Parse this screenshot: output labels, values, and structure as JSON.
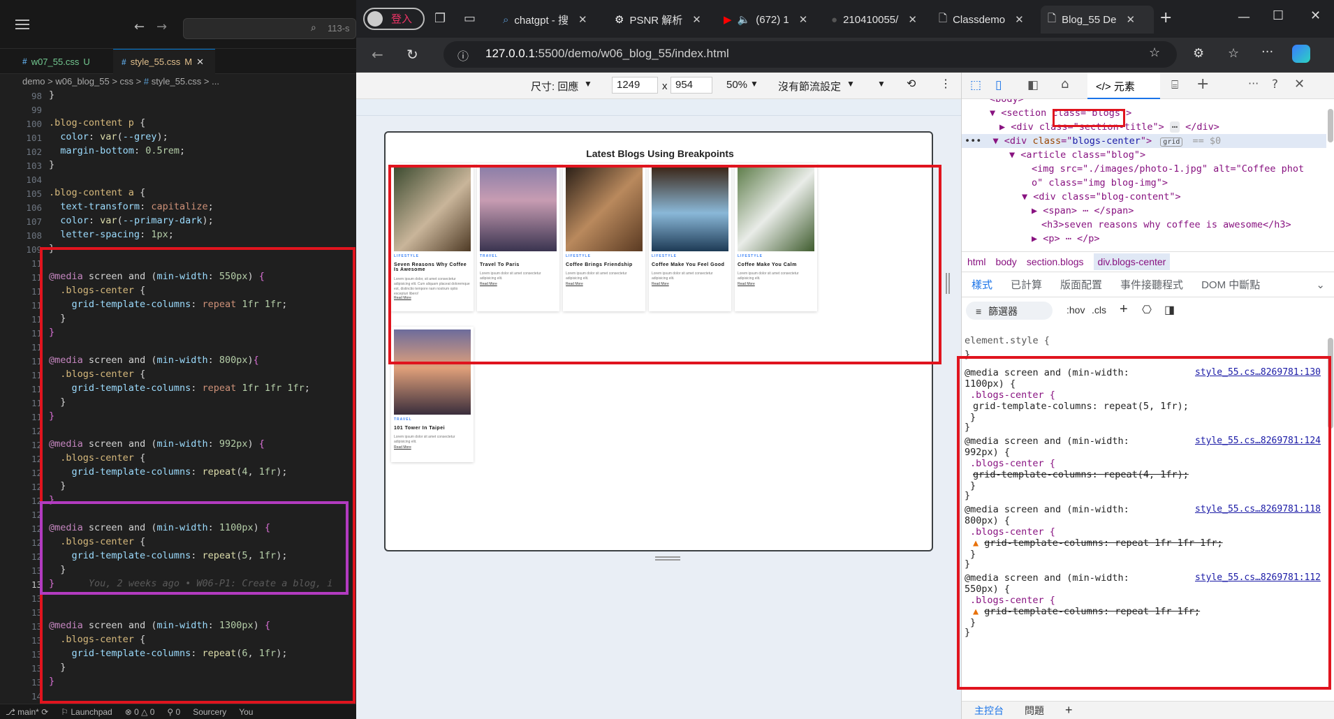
{
  "vscode": {
    "tabs": [
      {
        "label": "w07_55.css",
        "status": "U"
      },
      {
        "label": "style_55.css",
        "status": "M"
      }
    ],
    "breadcrumb": [
      "demo",
      "w06_blog_55",
      "css",
      "#",
      "style_55.css",
      "..."
    ],
    "search_text": "113-s",
    "line_numbers": [
      "98",
      "99",
      "100",
      "101",
      "102",
      "103",
      "104",
      "105",
      "106",
      "107",
      "108",
      "109",
      "11",
      "11",
      "11",
      "11",
      "11",
      "11",
      "11",
      "11",
      "11",
      "11",
      "11",
      "11",
      "12",
      "12",
      "12",
      "12",
      "12",
      "12",
      "12",
      "12",
      "12",
      "12",
      "13",
      "13",
      "13",
      "13",
      "13",
      "13",
      "13",
      "13",
      "13",
      "14"
    ],
    "status": {
      "branch": "main*",
      "launchpad": "Launchpad",
      "problems": "0 △ 0",
      "ports": "0",
      "sourcery": "Sourcery",
      "you": "You"
    },
    "blame": "You, 2 weeks ago • W06-P1: Create a blog, i"
  },
  "browser": {
    "profile_label": "登入",
    "tabs": [
      {
        "label": "chatgpt - 搜"
      },
      {
        "label": "PSNR 解析"
      },
      {
        "label": "(672) 1"
      },
      {
        "label": "210410055/"
      },
      {
        "label": "Classdemo"
      },
      {
        "label": "Blog_55 De"
      }
    ],
    "url_host": "127.0.0.1",
    "url_path": ":5500/demo/w06_blog_55/index.html",
    "device_toolbar": {
      "size_label": "尺寸: 回應",
      "width": "1249",
      "times": "x",
      "height": "954",
      "zoom": "50%",
      "throttle": "沒有節流設定"
    }
  },
  "page": {
    "title": "Latest Blogs Using Breakpoints",
    "cards": [
      {
        "category": "LIFESTYLE",
        "title": "Seven Reasons Why Coffee Is Awesome",
        "text": "Lorem ipsum dolor, sit amet consectetur adipisicing elit. Cum aliquam placeat doloremque est, distinctio tempore nam nostrum optio excepturi libero!",
        "link": "Read More"
      },
      {
        "category": "TRAVEL",
        "title": "Travel To Paris",
        "text": "Lorem ipsum dolor sit amet consectetur adipisicing elit.",
        "link": "Read More"
      },
      {
        "category": "LIFESTYLE",
        "title": "Coffee Brings Friendship",
        "text": "Lorem ipsum dolor sit amet consectetur adipisicing elit.",
        "link": "Read More"
      },
      {
        "category": "LIFESTYLE",
        "title": "Coffee Make You Feel Good",
        "text": "Lorem ipsum dolor sit amet consectetur adipisicing elit.",
        "link": "Read More"
      },
      {
        "category": "LIFESTYLE",
        "title": "Coffee Make You Calm",
        "text": "Lorem ipsum dolor sit amet consectetur adipisicing elit.",
        "link": "Read More"
      },
      {
        "category": "TRAVEL",
        "title": "101 Tower In Taipei",
        "text": "Lorem ipsum dolor sit amet consectetur adipisicing elit.",
        "link": "Read More"
      }
    ]
  },
  "devtools": {
    "tabs": [
      "元素"
    ],
    "dom": {
      "body": "<body>",
      "section_open": "<section class=\"blogs\">",
      "section_title": "<div class=\"section-title\">",
      "blogs_center_class": "blogs-center",
      "grid_badge": "grid",
      "eq": "== $0",
      "article": "<article class=\"blog\">",
      "img_line1": "<img src=\"./images/photo-1.jpg\" alt=\"Coffee phot",
      "img_line2": "o\" class=\"img blog-img\">",
      "blog_content": "<div class=\"blog-content\">",
      "span": "<span>",
      "h3": "<h3>seven reasons why coffee is awesome</h3>",
      "p": "<p>"
    },
    "crumbs": [
      "html",
      "body",
      "section.blogs",
      "div.blogs-center"
    ],
    "subtabs": [
      "樣式",
      "已計算",
      "版面配置",
      "事件接聽程式",
      "DOM 中斷點"
    ],
    "filter_placeholder": "篩選器",
    "filter_hov": ":hov",
    "filter_cls": ".cls",
    "element_style": "element.style {",
    "rules": [
      {
        "media": "@media screen and (min-width:",
        "media2": "1100px) {",
        "link": "style_55.cs…8269781:130",
        "selector": ".blogs-center {",
        "decl": "grid-template-columns: repeat(5, 1fr);",
        "struck": false,
        "warn": false
      },
      {
        "media": "@media screen and (min-width:",
        "media2": "992px) {",
        "link": "style_55.cs…8269781:124",
        "selector": ".blogs-center {",
        "decl": "grid-template-columns: repeat(4, 1fr);",
        "struck": true,
        "warn": false
      },
      {
        "media": "@media screen and (min-width:",
        "media2": "800px) {",
        "link": "style_55.cs…8269781:118",
        "selector": ".blogs-center {",
        "decl": "grid-template-columns: repeat 1fr 1fr 1fr;",
        "struck": true,
        "warn": true
      },
      {
        "media": "@media screen and (min-width:",
        "media2": "550px) {",
        "link": "style_55.cs…8269781:112",
        "selector": ".blogs-center {",
        "decl": "grid-template-columns: repeat 1fr 1fr;",
        "struck": true,
        "warn": true
      }
    ],
    "drawer": [
      "主控台",
      "問題"
    ]
  }
}
